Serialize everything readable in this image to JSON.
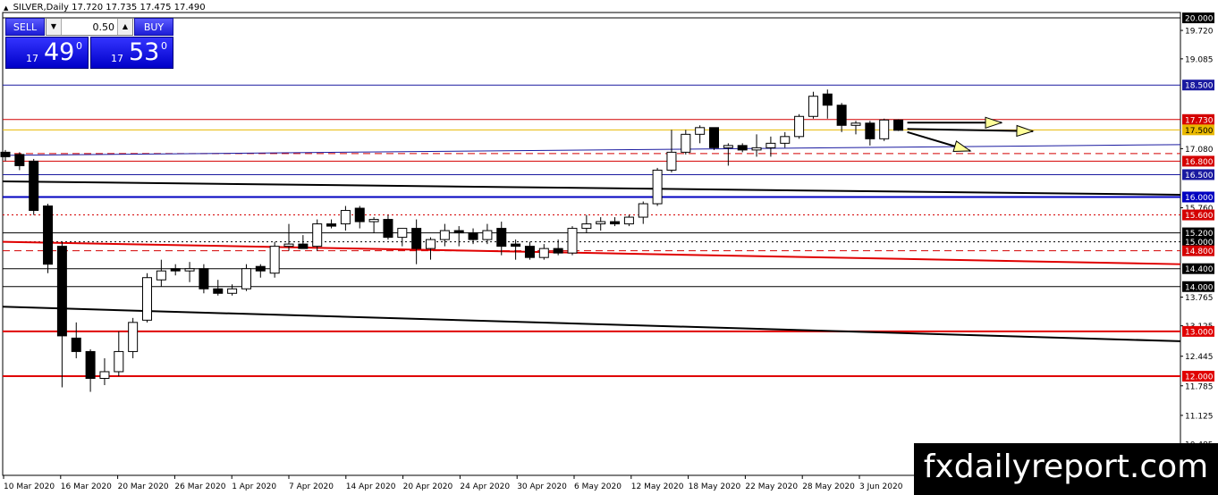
{
  "window": {
    "symbol": "SILVER,Daily",
    "ohlc": "17.720 17.735 17.475 17.490"
  },
  "trade_panel": {
    "sell_label": "SELL",
    "buy_label": "BUY",
    "lot_value": "0.50",
    "down_arrow": "▼",
    "up_arrow": "▲",
    "sell_price": {
      "prefix": "17",
      "main": "49",
      "sup": "0"
    },
    "buy_price": {
      "prefix": "17",
      "main": "53",
      "sup": "0"
    }
  },
  "brand": {
    "text": "fxdailyreport.com"
  },
  "chart_data": {
    "type": "candlestick",
    "title": "SILVER,Daily",
    "ylim": [
      10.5,
      20.3
    ],
    "price_axis_ticks": [
      "20.000",
      "19.720",
      "19.085",
      "18.500",
      "17.730",
      "17.500",
      "17.080",
      "16.800",
      "16.500",
      "16.000",
      "15.760",
      "15.600",
      "15.200",
      "15.000",
      "14.800",
      "14.400",
      "14.000",
      "13.765",
      "13.125",
      "13.000",
      "12.445",
      "12.000",
      "11.785",
      "11.125",
      "10.485"
    ],
    "highlighted_levels": [
      {
        "value": 20.0,
        "label": "20.000",
        "color": "#000000",
        "style": "solid"
      },
      {
        "value": 18.5,
        "label": "18.500",
        "color": "#1a1aa0",
        "style": "solid"
      },
      {
        "value": 17.73,
        "label": "17.730",
        "color": "#d40000",
        "style": "solid"
      },
      {
        "value": 17.5,
        "label": "17.500",
        "color": "#e8b800",
        "style": "solid"
      },
      {
        "value": 16.8,
        "label": "16.800",
        "color": "#d40000",
        "style": "solid"
      },
      {
        "value": 16.5,
        "label": "16.500",
        "color": "#1a1aa0",
        "style": "solid"
      },
      {
        "value": 16.0,
        "label": "16.000",
        "color": "#0000c0",
        "style": "solid"
      },
      {
        "value": 15.6,
        "label": "15.600",
        "color": "#d40000",
        "style": "dotted"
      },
      {
        "value": 15.2,
        "label": "15.200",
        "color": "#000000",
        "style": "solid"
      },
      {
        "value": 15.0,
        "label": "15.000",
        "color": "#000000",
        "style": "dotted"
      },
      {
        "value": 14.8,
        "label": "14.800",
        "color": "#d40000",
        "style": "dashed"
      },
      {
        "value": 14.4,
        "label": "14.400",
        "color": "#000000",
        "style": "solid"
      },
      {
        "value": 14.0,
        "label": "14.000",
        "color": "#000000",
        "style": "solid"
      },
      {
        "value": 13.0,
        "label": "13.000",
        "color": "#e00000",
        "style": "solid"
      },
      {
        "value": 12.0,
        "label": "12.000",
        "color": "#e00000",
        "style": "solid"
      }
    ],
    "x_labels": [
      "10 Mar 2020",
      "16 Mar 2020",
      "20 Mar 2020",
      "26 Mar 2020",
      "1 Apr 2020",
      "7 Apr 2020",
      "14 Apr 2020",
      "20 Apr 2020",
      "24 Apr 2020",
      "30 Apr 2020",
      "6 May 2020",
      "12 May 2020",
      "18 May 2020",
      "22 May 2020",
      "28 May 2020",
      "3 Jun 2020"
    ],
    "candles": [
      {
        "o": 17.0,
        "h": 17.05,
        "l": 16.8,
        "c": 16.9
      },
      {
        "o": 16.95,
        "h": 17.0,
        "l": 16.6,
        "c": 16.7
      },
      {
        "o": 16.8,
        "h": 16.85,
        "l": 15.6,
        "c": 15.7
      },
      {
        "o": 15.8,
        "h": 15.85,
        "l": 14.3,
        "c": 14.5
      },
      {
        "o": 14.9,
        "h": 15.0,
        "l": 11.75,
        "c": 12.9
      },
      {
        "o": 12.85,
        "h": 13.2,
        "l": 12.4,
        "c": 12.55
      },
      {
        "o": 12.55,
        "h": 12.6,
        "l": 11.65,
        "c": 11.95
      },
      {
        "o": 11.95,
        "h": 12.4,
        "l": 11.8,
        "c": 12.1
      },
      {
        "o": 12.1,
        "h": 13.0,
        "l": 12.0,
        "c": 12.55
      },
      {
        "o": 12.55,
        "h": 13.3,
        "l": 12.4,
        "c": 13.2
      },
      {
        "o": 13.25,
        "h": 14.3,
        "l": 13.2,
        "c": 14.2
      },
      {
        "o": 14.15,
        "h": 14.6,
        "l": 14.0,
        "c": 14.35
      },
      {
        "o": 14.4,
        "h": 14.5,
        "l": 14.25,
        "c": 14.35
      },
      {
        "o": 14.35,
        "h": 14.55,
        "l": 14.1,
        "c": 14.4
      },
      {
        "o": 14.4,
        "h": 14.5,
        "l": 13.85,
        "c": 13.95
      },
      {
        "o": 13.95,
        "h": 14.15,
        "l": 13.8,
        "c": 13.85
      },
      {
        "o": 13.85,
        "h": 14.05,
        "l": 13.8,
        "c": 13.95
      },
      {
        "o": 13.95,
        "h": 14.5,
        "l": 13.9,
        "c": 14.4
      },
      {
        "o": 14.45,
        "h": 14.5,
        "l": 14.2,
        "c": 14.35
      },
      {
        "o": 14.3,
        "h": 15.0,
        "l": 14.2,
        "c": 14.9
      },
      {
        "o": 14.9,
        "h": 15.4,
        "l": 14.8,
        "c": 14.95
      },
      {
        "o": 14.95,
        "h": 15.15,
        "l": 14.85,
        "c": 14.85
      },
      {
        "o": 14.9,
        "h": 15.5,
        "l": 14.8,
        "c": 15.4
      },
      {
        "o": 15.4,
        "h": 15.5,
        "l": 15.3,
        "c": 15.35
      },
      {
        "o": 15.4,
        "h": 15.8,
        "l": 15.25,
        "c": 15.7
      },
      {
        "o": 15.75,
        "h": 15.8,
        "l": 15.3,
        "c": 15.45
      },
      {
        "o": 15.45,
        "h": 15.55,
        "l": 15.2,
        "c": 15.5
      },
      {
        "o": 15.5,
        "h": 15.6,
        "l": 15.05,
        "c": 15.1
      },
      {
        "o": 15.1,
        "h": 15.3,
        "l": 14.9,
        "c": 15.3
      },
      {
        "o": 15.3,
        "h": 15.5,
        "l": 14.5,
        "c": 14.85
      },
      {
        "o": 14.85,
        "h": 15.1,
        "l": 14.6,
        "c": 15.05
      },
      {
        "o": 15.05,
        "h": 15.4,
        "l": 14.9,
        "c": 15.25
      },
      {
        "o": 15.25,
        "h": 15.35,
        "l": 14.9,
        "c": 15.2
      },
      {
        "o": 15.2,
        "h": 15.3,
        "l": 14.95,
        "c": 15.05
      },
      {
        "o": 15.05,
        "h": 15.4,
        "l": 14.95,
        "c": 15.25
      },
      {
        "o": 15.3,
        "h": 15.45,
        "l": 14.7,
        "c": 14.9
      },
      {
        "o": 14.95,
        "h": 15.05,
        "l": 14.6,
        "c": 14.9
      },
      {
        "o": 14.9,
        "h": 15.0,
        "l": 14.6,
        "c": 14.65
      },
      {
        "o": 14.65,
        "h": 14.95,
        "l": 14.6,
        "c": 14.85
      },
      {
        "o": 14.85,
        "h": 15.05,
        "l": 14.7,
        "c": 14.75
      },
      {
        "o": 14.75,
        "h": 15.35,
        "l": 14.7,
        "c": 15.3
      },
      {
        "o": 15.3,
        "h": 15.6,
        "l": 15.2,
        "c": 15.4
      },
      {
        "o": 15.4,
        "h": 15.55,
        "l": 15.25,
        "c": 15.45
      },
      {
        "o": 15.45,
        "h": 15.55,
        "l": 15.35,
        "c": 15.4
      },
      {
        "o": 15.4,
        "h": 15.6,
        "l": 15.35,
        "c": 15.55
      },
      {
        "o": 15.55,
        "h": 15.9,
        "l": 15.4,
        "c": 15.85
      },
      {
        "o": 15.85,
        "h": 16.65,
        "l": 15.8,
        "c": 16.6
      },
      {
        "o": 16.6,
        "h": 17.5,
        "l": 16.55,
        "c": 17.0
      },
      {
        "o": 17.0,
        "h": 17.5,
        "l": 16.95,
        "c": 17.4
      },
      {
        "o": 17.4,
        "h": 17.6,
        "l": 17.2,
        "c": 17.55
      },
      {
        "o": 17.55,
        "h": 17.55,
        "l": 17.05,
        "c": 17.1
      },
      {
        "o": 17.1,
        "h": 17.2,
        "l": 16.7,
        "c": 17.15
      },
      {
        "o": 17.15,
        "h": 17.2,
        "l": 17.0,
        "c": 17.05
      },
      {
        "o": 17.05,
        "h": 17.4,
        "l": 16.9,
        "c": 17.1
      },
      {
        "o": 17.1,
        "h": 17.35,
        "l": 16.9,
        "c": 17.2
      },
      {
        "o": 17.2,
        "h": 17.45,
        "l": 17.1,
        "c": 17.35
      },
      {
        "o": 17.35,
        "h": 17.85,
        "l": 17.3,
        "c": 17.8
      },
      {
        "o": 17.8,
        "h": 18.35,
        "l": 17.75,
        "c": 18.25
      },
      {
        "o": 18.3,
        "h": 18.4,
        "l": 17.75,
        "c": 18.05
      },
      {
        "o": 18.05,
        "h": 18.1,
        "l": 17.45,
        "c": 17.6
      },
      {
        "o": 17.6,
        "h": 17.7,
        "l": 17.4,
        "c": 17.65
      },
      {
        "o": 17.65,
        "h": 17.7,
        "l": 17.15,
        "c": 17.3
      },
      {
        "o": 17.3,
        "h": 17.75,
        "l": 17.25,
        "c": 17.72
      },
      {
        "o": 17.72,
        "h": 17.735,
        "l": 17.475,
        "c": 17.49
      }
    ]
  }
}
